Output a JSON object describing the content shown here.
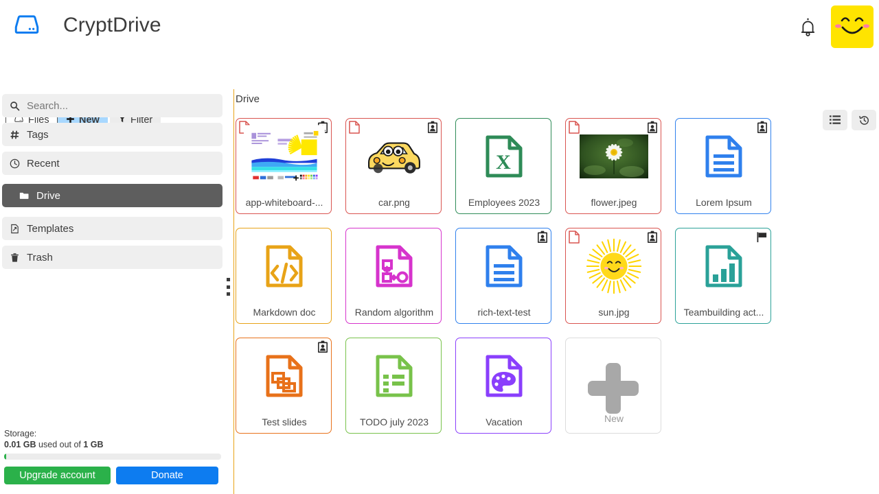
{
  "header": {
    "brand_title": "CryptDrive",
    "brand_icon": "drive-icon",
    "bell_icon": "bell-icon",
    "avatar_icon": "smiley-avatar"
  },
  "toolbar": {
    "files_label": "Files",
    "files_icon": "drive-icon",
    "new_label": "New",
    "new_icon": "plus-icon",
    "filter_label": "Filter",
    "filter_icon": "funnel-icon",
    "listview_icon": "list-view-icon",
    "history_icon": "history-icon"
  },
  "sidebar": {
    "items": [
      {
        "label": "Search...",
        "icon": "search-icon",
        "active": false
      },
      {
        "label": "Tags",
        "icon": "hash-icon",
        "active": false
      },
      {
        "label": "Recent",
        "icon": "clock-icon",
        "active": false
      },
      {
        "label": "Drive",
        "icon": "folder-icon",
        "active": true
      },
      {
        "label": "Templates",
        "icon": "template-icon",
        "active": false
      },
      {
        "label": "Trash",
        "icon": "trash-icon",
        "active": false
      }
    ],
    "storage": {
      "title": "Storage:",
      "used": "0.01 GB",
      "middle_text": " used out of ",
      "total": "1 GB",
      "percent": 1,
      "upgrade_label": "Upgrade account",
      "donate_label": "Donate",
      "upgrade_color": "#2bb14a",
      "donate_color": "#0d7cf0",
      "bar_color": "#2bb14a"
    }
  },
  "main": {
    "breadcrumb": "Drive",
    "files": [
      {
        "name": "app-whiteboard-...",
        "border": "#d9534f",
        "thumb": "whiteboard",
        "page_corner": true,
        "badge": true,
        "flag": false
      },
      {
        "name": "car.png",
        "border": "#d9534f",
        "thumb": "car",
        "page_corner": true,
        "badge": true,
        "flag": false
      },
      {
        "name": "Employees 2023",
        "border": "#2e8b57",
        "thumb": "sheet",
        "page_corner": false,
        "badge": false,
        "flag": false,
        "icon_color": "#2e8b57"
      },
      {
        "name": "flower.jpeg",
        "border": "#d9534f",
        "thumb": "flower",
        "page_corner": true,
        "badge": true,
        "flag": false
      },
      {
        "name": "Lorem Ipsum",
        "border": "#2f80ed",
        "thumb": "doc",
        "page_corner": false,
        "badge": true,
        "flag": false,
        "icon_color": "#2f80ed"
      },
      {
        "name": "Markdown doc",
        "border": "#e8a317",
        "thumb": "code",
        "page_corner": false,
        "badge": false,
        "flag": false,
        "icon_color": "#e8a317"
      },
      {
        "name": "Random algorithm",
        "border": "#d633cc",
        "thumb": "diagram",
        "page_corner": false,
        "badge": false,
        "flag": false,
        "icon_color": "#d633cc"
      },
      {
        "name": "rich-text-test",
        "border": "#2f80ed",
        "thumb": "doc",
        "page_corner": false,
        "badge": true,
        "flag": false,
        "icon_color": "#2f80ed"
      },
      {
        "name": "sun.jpg",
        "border": "#d9534f",
        "thumb": "sun",
        "page_corner": true,
        "badge": true,
        "flag": false
      },
      {
        "name": "Teambuilding act...",
        "border": "#2aa198",
        "thumb": "chart",
        "page_corner": false,
        "badge": false,
        "flag": true,
        "icon_color": "#2aa198"
      },
      {
        "name": "Test slides",
        "border": "#e8711a",
        "thumb": "slides",
        "page_corner": false,
        "badge": true,
        "flag": false,
        "icon_color": "#e8711a"
      },
      {
        "name": "TODO july 2023",
        "border": "#78c24a",
        "thumb": "todo",
        "page_corner": false,
        "badge": false,
        "flag": false,
        "icon_color": "#78c24a"
      },
      {
        "name": "Vacation",
        "border": "#8a3ffc",
        "thumb": "palette",
        "page_corner": false,
        "badge": false,
        "flag": false,
        "icon_color": "#8a3ffc"
      }
    ],
    "new_card": {
      "label": "New",
      "icon": "plus-icon"
    }
  }
}
